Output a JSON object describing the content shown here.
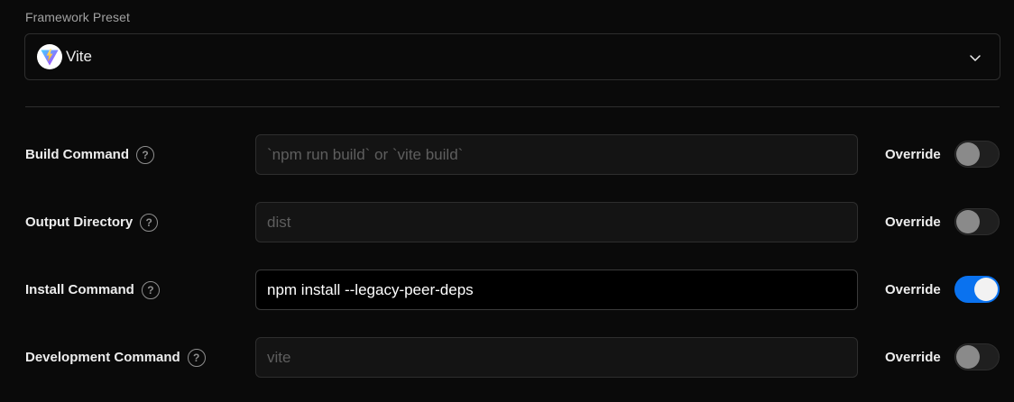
{
  "framework": {
    "label": "Framework Preset",
    "selected": "Vite",
    "logo_icon": "vite-logo-icon",
    "expand_icon": "chevron-down-icon"
  },
  "settings": [
    {
      "key": "build",
      "label": "Build Command",
      "value": "",
      "placeholder": "`npm run build` or `vite build`",
      "override_label": "Override",
      "override_on": false
    },
    {
      "key": "output",
      "label": "Output Directory",
      "value": "",
      "placeholder": "dist",
      "override_label": "Override",
      "override_on": false
    },
    {
      "key": "install",
      "label": "Install Command",
      "value": "npm install --legacy-peer-deps",
      "placeholder": "",
      "override_label": "Override",
      "override_on": true
    },
    {
      "key": "dev",
      "label": "Development Command",
      "value": "",
      "placeholder": "vite",
      "override_label": "Override",
      "override_on": false
    }
  ],
  "help_icon": "question-circle-icon",
  "colors": {
    "background": "#0a0a0a",
    "toggle_on": "#0a72ef",
    "toggle_off": "#1f1f1f"
  }
}
